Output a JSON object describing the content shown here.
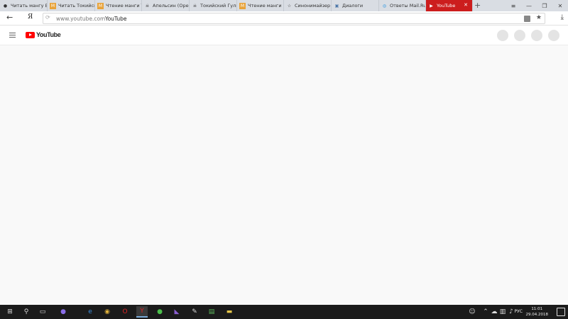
{
  "tabs": [
    {
      "label": "Читать мангу Ва",
      "icon": "globe-icon",
      "glyph": "●",
      "color": "#333333"
    },
    {
      "label": "Читать Токийск",
      "icon": "manga-m-icon",
      "glyph": "M",
      "color": "#e8a33a"
    },
    {
      "label": "Чтение манги Т",
      "icon": "manga-m-icon",
      "glyph": "M",
      "color": "#e8a33a"
    },
    {
      "label": "Апельсин (Оре",
      "icon": "skull-icon",
      "glyph": "☠",
      "color": "#555555"
    },
    {
      "label": "Токийский Гуль",
      "icon": "skull-icon",
      "glyph": "☠",
      "color": "#555555"
    },
    {
      "label": "Чтение манги Б",
      "icon": "manga-m-icon",
      "glyph": "M",
      "color": "#e8a33a"
    },
    {
      "label": "Синонимайзер",
      "icon": "star-icon",
      "glyph": "☆",
      "color": "#333333"
    },
    {
      "label": "Диалоги",
      "icon": "chat-icon",
      "glyph": "▣",
      "color": "#4a76a8"
    },
    {
      "label": "Ответы Mail.Ru",
      "icon": "mailru-icon",
      "glyph": "◎",
      "color": "#168de2"
    },
    {
      "label": "YouTube",
      "icon": "youtube-icon",
      "glyph": "▶",
      "color": "#ffffff",
      "active": true
    }
  ],
  "window_controls": [
    "≡",
    "—",
    "❐",
    "✕"
  ],
  "address": {
    "back": "←",
    "browser_logo": "Я",
    "domain": "www.youtube.com",
    "title": "YouTube"
  },
  "youtube": {
    "logo_text": "YouTube"
  },
  "taskbar": {
    "time": "11:01",
    "date": "29.04.2018",
    "lang": "РУС"
  },
  "colors": {
    "tab_active": "#cc1d1d",
    "youtube_red": "#ff0000",
    "taskbar": "#1b1b1b"
  }
}
